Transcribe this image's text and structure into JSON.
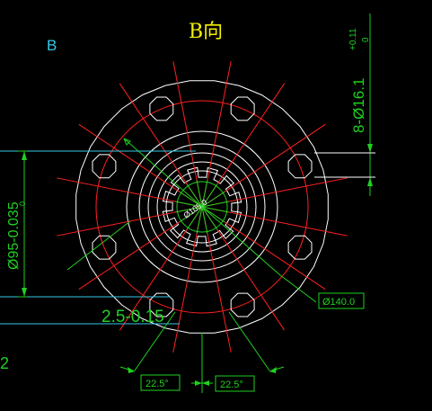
{
  "view_title": "B向",
  "view_letter": "B",
  "dimensions": {
    "holes": "8-Ø16.1",
    "holes_tol_upper": "+0.11",
    "holes_tol_lower": "0",
    "outer_diameter": "Ø95-0.035",
    "outer_tol": "0",
    "pcd": "Ø140.0",
    "inner": "Ø105.0",
    "depth": "2.5-0.15",
    "left_edge_value": "2",
    "angle_left": "22.5°",
    "angle_right": "22.5°"
  },
  "colors": {
    "background": "#000000",
    "outline": "#ffffff",
    "center_lines": "#ff2020",
    "dimension": "#20d020",
    "annotation": "#33c8e8",
    "title": "#f4f000"
  }
}
